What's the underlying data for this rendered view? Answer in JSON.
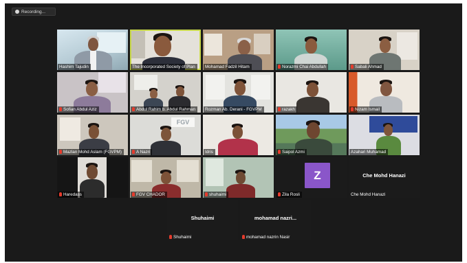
{
  "recording": {
    "label": "Recording..."
  },
  "participants": [
    {
      "name": "Hashim Tajudin"
    },
    {
      "name": "The Incorporated Society of Plan"
    },
    {
      "name": "Mohamad Fadzil Hitam"
    },
    {
      "name": "Norazmi Chai Abdullah"
    },
    {
      "name": "Sabali Ahmad"
    },
    {
      "name": "Sofian Abdul Aziz"
    },
    {
      "name": "Abdul Rahim b. Abdul Rahman"
    },
    {
      "name": "Rozman Ab. Derani - FGVPM"
    },
    {
      "name": "razakh"
    },
    {
      "name": "Nizam Ismail"
    },
    {
      "name": "Mazlan Mohd Aslam (FGVPM)"
    },
    {
      "name": "A Nazri"
    },
    {
      "name": "Idris"
    },
    {
      "name": "Saipol Azmi"
    },
    {
      "name": "Azahari Muhamad"
    },
    {
      "name": "Haredass"
    },
    {
      "name": "FGV CHADOR"
    },
    {
      "name": "shuhaimi"
    },
    {
      "name": "Zila Rosli",
      "avatar_letter": "Z"
    },
    {
      "name": "Che Mohd Hanazi",
      "display": "Che Mohd Hanazi"
    },
    {
      "name": "Shuhaimi",
      "display": "Shuhaimi"
    },
    {
      "name": "mohamad nazrin Nasir",
      "display": "mohamad  nazri..."
    }
  ],
  "sign": {
    "text": "FGV"
  },
  "colors": {
    "active_speaker": "#c9d94c",
    "muted_mic": "#e53b2c",
    "avatar_bg": "#8a56c9"
  }
}
